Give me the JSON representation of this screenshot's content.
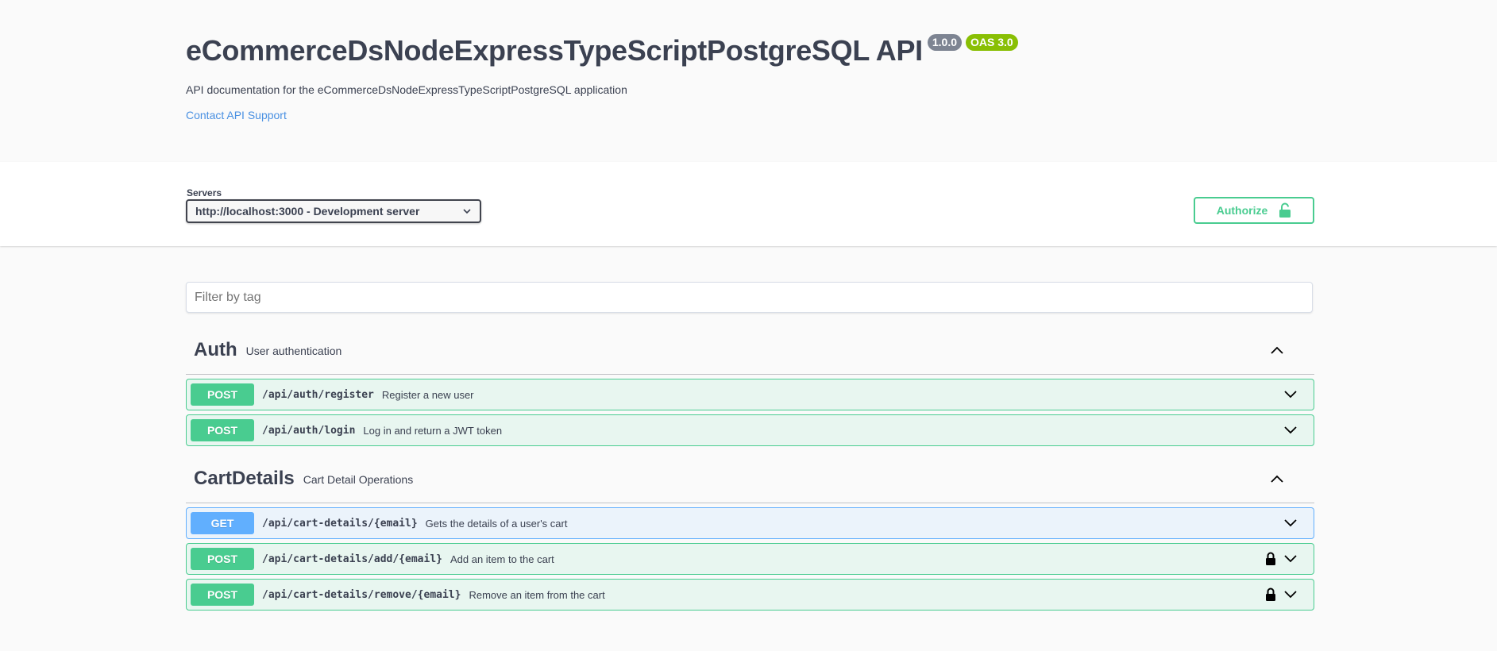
{
  "info": {
    "title": "eCommerceDsNodeExpressTypeScriptPostgreSQL API",
    "version_badge": "1.0.0",
    "oas_badge": "OAS 3.0",
    "description": "API documentation for the eCommerceDsNodeExpressTypeScriptPostgreSQL application",
    "contact_link": "Contact API Support"
  },
  "scheme": {
    "servers_label": "Servers",
    "selected_server": "http://localhost:3000 - Development server",
    "authorize_label": "Authorize"
  },
  "filter": {
    "placeholder": "Filter by tag"
  },
  "tags": [
    {
      "name": "Auth",
      "description": "User authentication",
      "operations": [
        {
          "method": "POST",
          "path": "/api/auth/register",
          "summary": "Register a new user"
        },
        {
          "method": "POST",
          "path": "/api/auth/login",
          "summary": "Log in and return a JWT token"
        }
      ]
    },
    {
      "name": "CartDetails",
      "description": "Cart Detail Operations",
      "operations": [
        {
          "method": "GET",
          "path": "/api/cart-details/{email}",
          "summary": "Gets the details of a user's cart"
        },
        {
          "method": "POST",
          "path": "/api/cart-details/add/{email}",
          "summary": "Add an item to the cart"
        },
        {
          "method": "POST",
          "path": "/api/cart-details/remove/{email}",
          "summary": "Remove an item from the cart"
        }
      ]
    }
  ],
  "colors": {
    "post": "#49cc90",
    "get": "#61affe",
    "badge_version": "#7d8492",
    "badge_oas": "#89bf04",
    "link": "#4990e2"
  }
}
